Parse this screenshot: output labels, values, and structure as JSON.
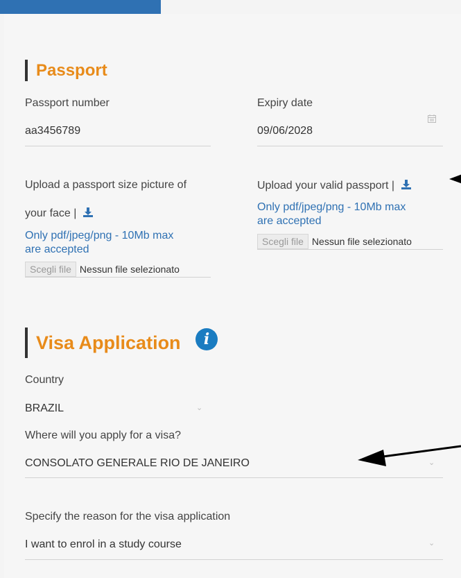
{
  "passport": {
    "title": "Passport",
    "number_label": "Passport number",
    "number_value": "aa3456789",
    "expiry_label": "Expiry date",
    "expiry_value": "09/06/2028",
    "photo_label_line1": "Upload a passport size picture of",
    "photo_label_line2": "your face |",
    "photo_hint_line1": "Only pdf/jpeg/png - 10Mb max",
    "photo_hint_line2": "are accepted",
    "passport_upload_label": "Upload your valid passport |",
    "passport_hint_line1": "Only pdf/jpeg/png - 10Mb max",
    "passport_hint_line2": "are accepted",
    "choose_file": "Scegli file",
    "no_file": "Nessun file selezionato"
  },
  "visa": {
    "title": "Visa Application",
    "info_glyph": "i",
    "country_label": "Country",
    "country_value": "BRAZIL",
    "apply_label": "Where will you apply for a visa?",
    "apply_value": "CONSOLATO GENERALE RIO DE JANEIRO",
    "reason_label": "Specify the reason for the visa application",
    "reason_value": "I want to enrol in a study course"
  },
  "colors": {
    "accent": "#e88b1a",
    "link": "#2f71b3",
    "info": "#1a7cc1"
  },
  "icons": {
    "calendar": "calendar-icon",
    "download": "download-icon",
    "chevron": "chevron-down-icon",
    "info": "info-icon"
  }
}
